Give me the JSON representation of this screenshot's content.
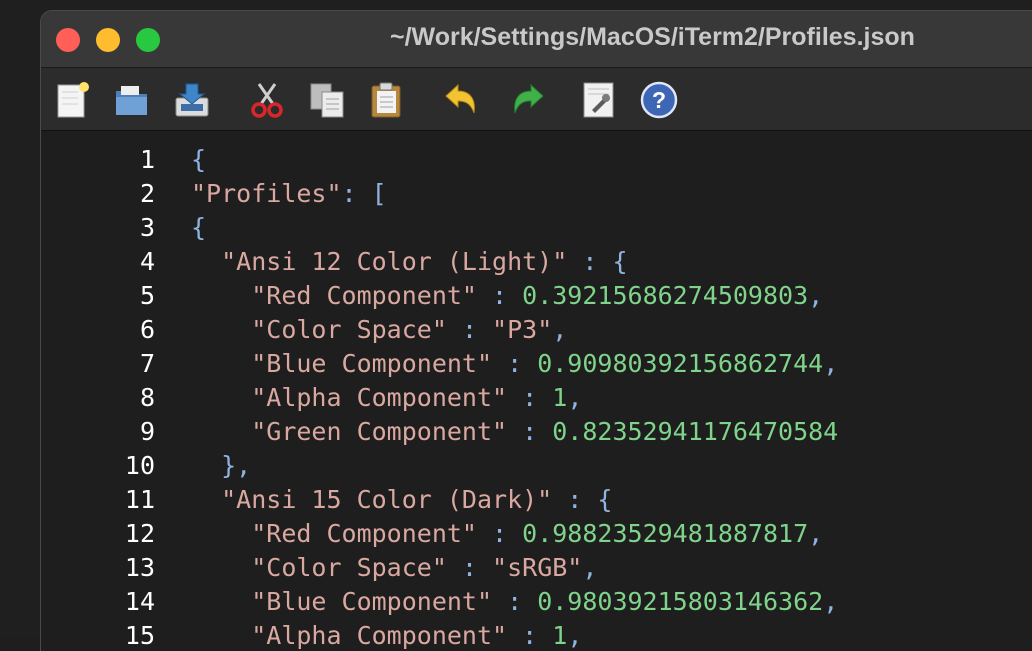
{
  "window": {
    "title": "~/Work/Settings/MacOS/iTerm2/Profiles.json",
    "colors": {
      "close": "#ff5f57",
      "minimize": "#febc2e",
      "maximize": "#28c840"
    }
  },
  "toolbar": {
    "buttons": [
      {
        "name": "new-file-button",
        "icon": "new-document-icon"
      },
      {
        "name": "open-file-button",
        "icon": "open-folder-icon"
      },
      {
        "name": "save-file-button",
        "icon": "save-icon"
      },
      {
        "name": "cut-button",
        "icon": "scissors-icon"
      },
      {
        "name": "copy-button",
        "icon": "copy-icon"
      },
      {
        "name": "paste-button",
        "icon": "clipboard-icon"
      },
      {
        "name": "undo-button",
        "icon": "undo-arrow-icon"
      },
      {
        "name": "redo-button",
        "icon": "redo-arrow-icon"
      },
      {
        "name": "settings-button",
        "icon": "document-settings-icon"
      },
      {
        "name": "help-button",
        "icon": "help-icon"
      }
    ]
  },
  "editor": {
    "lines": [
      {
        "n": "1",
        "tokens": [
          {
            "t": "{",
            "c": "p"
          }
        ]
      },
      {
        "n": "2",
        "tokens": [
          {
            "t": "\"Profiles\"",
            "c": "k"
          },
          {
            "t": ": ",
            "c": "p"
          },
          {
            "t": "[",
            "c": "p"
          }
        ]
      },
      {
        "n": "3",
        "tokens": [
          {
            "t": "{",
            "c": "p"
          }
        ]
      },
      {
        "n": "4",
        "tokens": [
          {
            "t": "  ",
            "c": "p"
          },
          {
            "t": "\"Ansi 12 Color (Light)\"",
            "c": "k"
          },
          {
            "t": " : {",
            "c": "p"
          }
        ]
      },
      {
        "n": "5",
        "tokens": [
          {
            "t": "    ",
            "c": "p"
          },
          {
            "t": "\"Red Component\"",
            "c": "k"
          },
          {
            "t": " : ",
            "c": "p"
          },
          {
            "t": "0.39215686274509803",
            "c": "n"
          },
          {
            "t": ",",
            "c": "p"
          }
        ]
      },
      {
        "n": "6",
        "tokens": [
          {
            "t": "    ",
            "c": "p"
          },
          {
            "t": "\"Color Space\"",
            "c": "k"
          },
          {
            "t": " : ",
            "c": "p"
          },
          {
            "t": "\"P3\"",
            "c": "s"
          },
          {
            "t": ",",
            "c": "p"
          }
        ]
      },
      {
        "n": "7",
        "tokens": [
          {
            "t": "    ",
            "c": "p"
          },
          {
            "t": "\"Blue Component\"",
            "c": "k"
          },
          {
            "t": " : ",
            "c": "p"
          },
          {
            "t": "0.90980392156862744",
            "c": "n"
          },
          {
            "t": ",",
            "c": "p"
          }
        ]
      },
      {
        "n": "8",
        "tokens": [
          {
            "t": "    ",
            "c": "p"
          },
          {
            "t": "\"Alpha Component\"",
            "c": "k"
          },
          {
            "t": " : ",
            "c": "p"
          },
          {
            "t": "1",
            "c": "n"
          },
          {
            "t": ",",
            "c": "p"
          }
        ]
      },
      {
        "n": "9",
        "tokens": [
          {
            "t": "    ",
            "c": "p"
          },
          {
            "t": "\"Green Component\"",
            "c": "k"
          },
          {
            "t": " : ",
            "c": "p"
          },
          {
            "t": "0.82352941176470584",
            "c": "n"
          }
        ]
      },
      {
        "n": "10",
        "tokens": [
          {
            "t": "  },",
            "c": "p"
          }
        ]
      },
      {
        "n": "11",
        "tokens": [
          {
            "t": "  ",
            "c": "p"
          },
          {
            "t": "\"Ansi 15 Color (Dark)\"",
            "c": "k"
          },
          {
            "t": " : {",
            "c": "p"
          }
        ]
      },
      {
        "n": "12",
        "tokens": [
          {
            "t": "    ",
            "c": "p"
          },
          {
            "t": "\"Red Component\"",
            "c": "k"
          },
          {
            "t": " : ",
            "c": "p"
          },
          {
            "t": "0.98823529481887817",
            "c": "n"
          },
          {
            "t": ",",
            "c": "p"
          }
        ]
      },
      {
        "n": "13",
        "tokens": [
          {
            "t": "    ",
            "c": "p"
          },
          {
            "t": "\"Color Space\"",
            "c": "k"
          },
          {
            "t": " : ",
            "c": "p"
          },
          {
            "t": "\"sRGB\"",
            "c": "s"
          },
          {
            "t": ",",
            "c": "p"
          }
        ]
      },
      {
        "n": "14",
        "tokens": [
          {
            "t": "    ",
            "c": "p"
          },
          {
            "t": "\"Blue Component\"",
            "c": "k"
          },
          {
            "t": " : ",
            "c": "p"
          },
          {
            "t": "0.98039215803146362",
            "c": "n"
          },
          {
            "t": ",",
            "c": "p"
          }
        ]
      },
      {
        "n": "15",
        "tokens": [
          {
            "t": "    ",
            "c": "p"
          },
          {
            "t": "\"Alpha Component\"",
            "c": "k"
          },
          {
            "t": " : ",
            "c": "p"
          },
          {
            "t": "1",
            "c": "n"
          },
          {
            "t": ",",
            "c": "p"
          }
        ]
      }
    ],
    "colors": {
      "keys": "#d9a8a0",
      "numbers": "#7fd38a",
      "punctuation": "#8fb4e0",
      "line_numbers": "#ffffff"
    }
  }
}
